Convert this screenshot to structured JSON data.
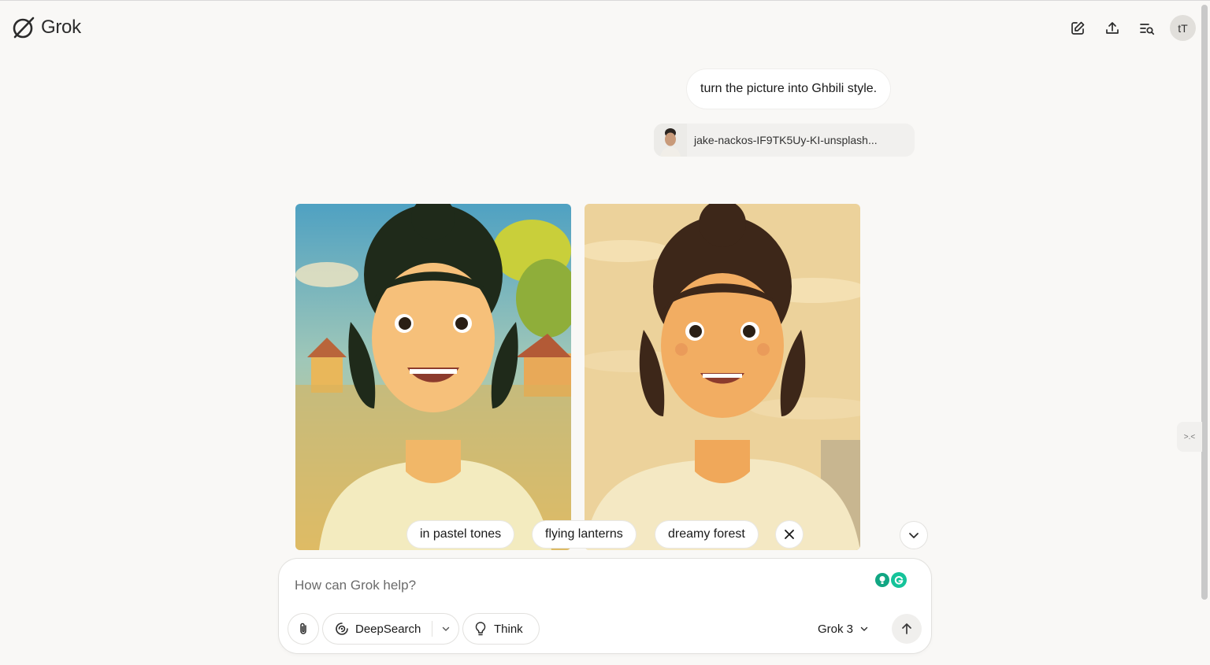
{
  "header": {
    "app_name": "Grok",
    "icons": [
      "grok-logo-icon",
      "edit-icon",
      "share-icon",
      "history-search-icon"
    ],
    "avatar_initials": "tT"
  },
  "conversation": {
    "user_message": "turn the picture into Ghbili style.",
    "attachment_name": "jake-nackos-IF9TK5Uy-KI-unsplash..."
  },
  "suggestions": {
    "items": [
      "in pastel tones",
      "flying lanterns",
      "dreamy forest"
    ]
  },
  "composer": {
    "placeholder": "How can Grok help?",
    "deepsearch_label": "DeepSearch",
    "think_label": "Think",
    "model_label": "Grok 3"
  },
  "colors": {
    "background": "#f9f8f6",
    "surface": "#ffffff",
    "grammarly_green": "#15c39a",
    "grammarly_teal": "#11a683"
  }
}
